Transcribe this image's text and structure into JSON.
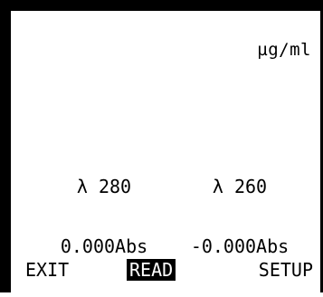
{
  "display": {
    "units": "µg/ml",
    "readings": [
      {
        "wavelength_label": "λ 280",
        "absorbance": "0.000Abs"
      },
      {
        "wavelength_label": "λ 260",
        "absorbance": "-0.000Abs"
      }
    ]
  },
  "softkeys": {
    "exit": "EXIT",
    "read": "READ",
    "setup": "SETUP"
  }
}
